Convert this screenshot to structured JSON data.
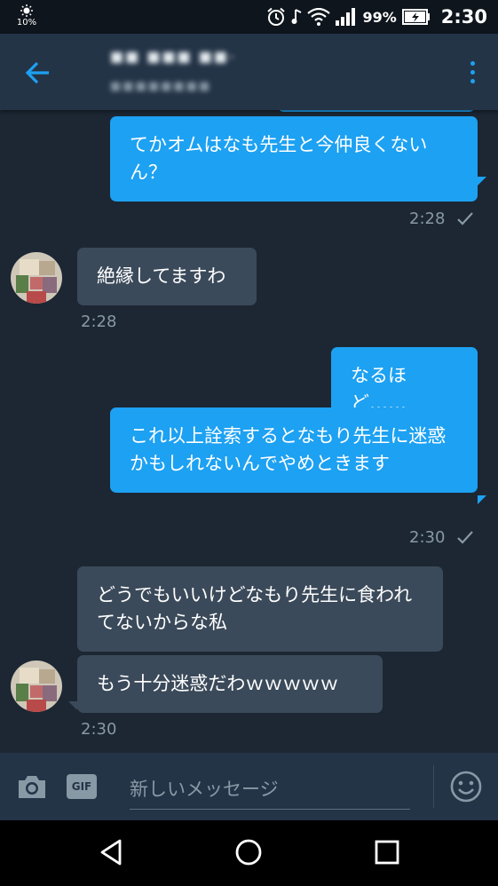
{
  "status_bar": {
    "brightness_pct": "10%",
    "battery_pct": "99%",
    "time": "2:30",
    "icons": [
      "alarm-icon",
      "music-note-icon",
      "wifi-icon",
      "signal-icon",
      "battery-charging-icon"
    ]
  },
  "header": {
    "back_icon": "arrow-left-icon",
    "name_obscured": "■■ ■■■ ■■-",
    "subtitle_obscured": "■■■■■■■■",
    "more_icon": "more-vertical-icon"
  },
  "messages": [
    {
      "dir": "out",
      "text": "てかオムはなも先生と今仲良くないん？"
    },
    {
      "dir": "meta-out",
      "time": "2:28",
      "status_icon": "check-icon"
    },
    {
      "dir": "in",
      "text": "絶縁してますわ"
    },
    {
      "dir": "meta-in",
      "time": "2:28"
    },
    {
      "dir": "out",
      "text": "なるほど……"
    },
    {
      "dir": "out",
      "text": "これ以上詮索するとなもり先生に迷惑かもしれないんでやめときます"
    },
    {
      "dir": "meta-out",
      "time": "2:30",
      "status_icon": "check-icon"
    },
    {
      "dir": "in",
      "text": "どうでもいいけどなもり先生に食われてないからな私"
    },
    {
      "dir": "in",
      "text": "もう十分迷惑だわｗｗｗｗｗ"
    },
    {
      "dir": "meta-in",
      "time": "2:30"
    }
  ],
  "composer": {
    "camera_icon": "camera-icon",
    "gif_label": "GIF",
    "placeholder": "新しいメッセージ",
    "emoji_icon": "smiley-icon"
  },
  "nav": {
    "back_icon": "triangle-back-icon",
    "home_icon": "circle-home-icon",
    "recents_icon": "square-recents-icon"
  },
  "colors": {
    "accent": "#1da1f2",
    "chat_bg": "#1c2733",
    "header_bg": "#243447",
    "incoming_bubble": "#3b4a5a",
    "meta_text": "#8899a6"
  }
}
